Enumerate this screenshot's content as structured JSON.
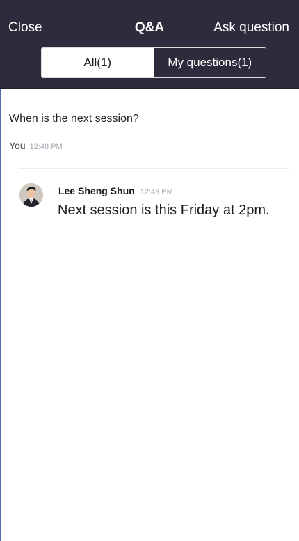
{
  "header": {
    "close_label": "Close",
    "title": "Q&A",
    "ask_label": "Ask question"
  },
  "tabs": {
    "all_label": "All(1)",
    "mine_label": "My questions(1)",
    "selected": "mine"
  },
  "question": {
    "text": "When is the next session?",
    "author": "You",
    "time": "12:48 PM"
  },
  "answer": {
    "author": "Lee Sheng Shun",
    "time": "12:49 PM",
    "text": "Next session is this Friday at 2pm."
  },
  "colors": {
    "header_bg": "#2d2c3d",
    "accent_text": "#ffffff",
    "meta_gray": "#a7a7b3"
  }
}
